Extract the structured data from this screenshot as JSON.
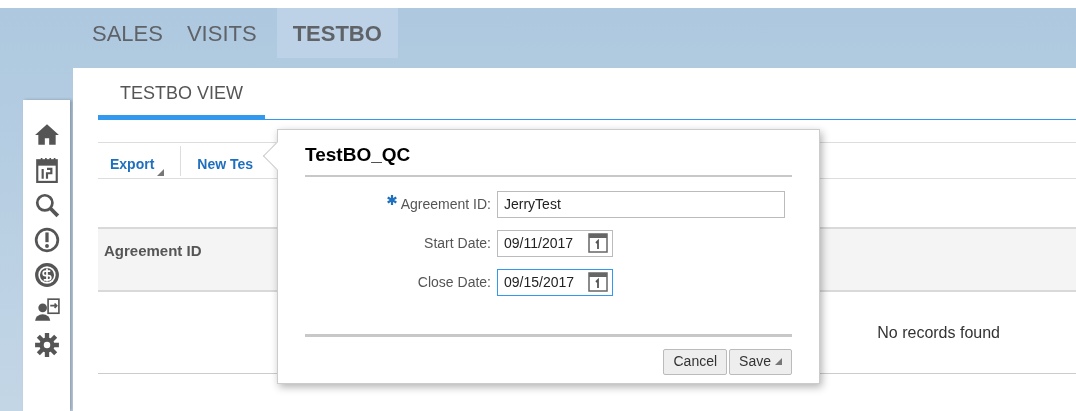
{
  "nav_tabs": [
    {
      "label": "SALES",
      "selected": false
    },
    {
      "label": "VISITS",
      "selected": false
    },
    {
      "label": "TESTBO",
      "selected": true
    }
  ],
  "view_tabs": [
    {
      "label": "TESTBO VIEW",
      "selected": true
    }
  ],
  "toolbar": [
    {
      "label": "Export",
      "has_menu": true
    },
    {
      "label": "New Tes",
      "has_menu": false
    }
  ],
  "table": {
    "columns": [
      "Agreement ID"
    ],
    "empty_message": "No records found"
  },
  "dialog": {
    "title": "TestBO_QC",
    "fields": [
      {
        "label": "Agreement ID:",
        "required": true,
        "kind": "text",
        "value": "JerryTest",
        "focused": false
      },
      {
        "label": "Start Date:",
        "required": false,
        "kind": "date",
        "value": "09/11/2017",
        "focused": false
      },
      {
        "label": "Close Date:",
        "required": false,
        "kind": "date",
        "value": "09/15/2017",
        "focused": true
      }
    ],
    "buttons": [
      {
        "label": "Cancel",
        "has_menu": false
      },
      {
        "label": "Save",
        "has_menu": true
      }
    ]
  }
}
